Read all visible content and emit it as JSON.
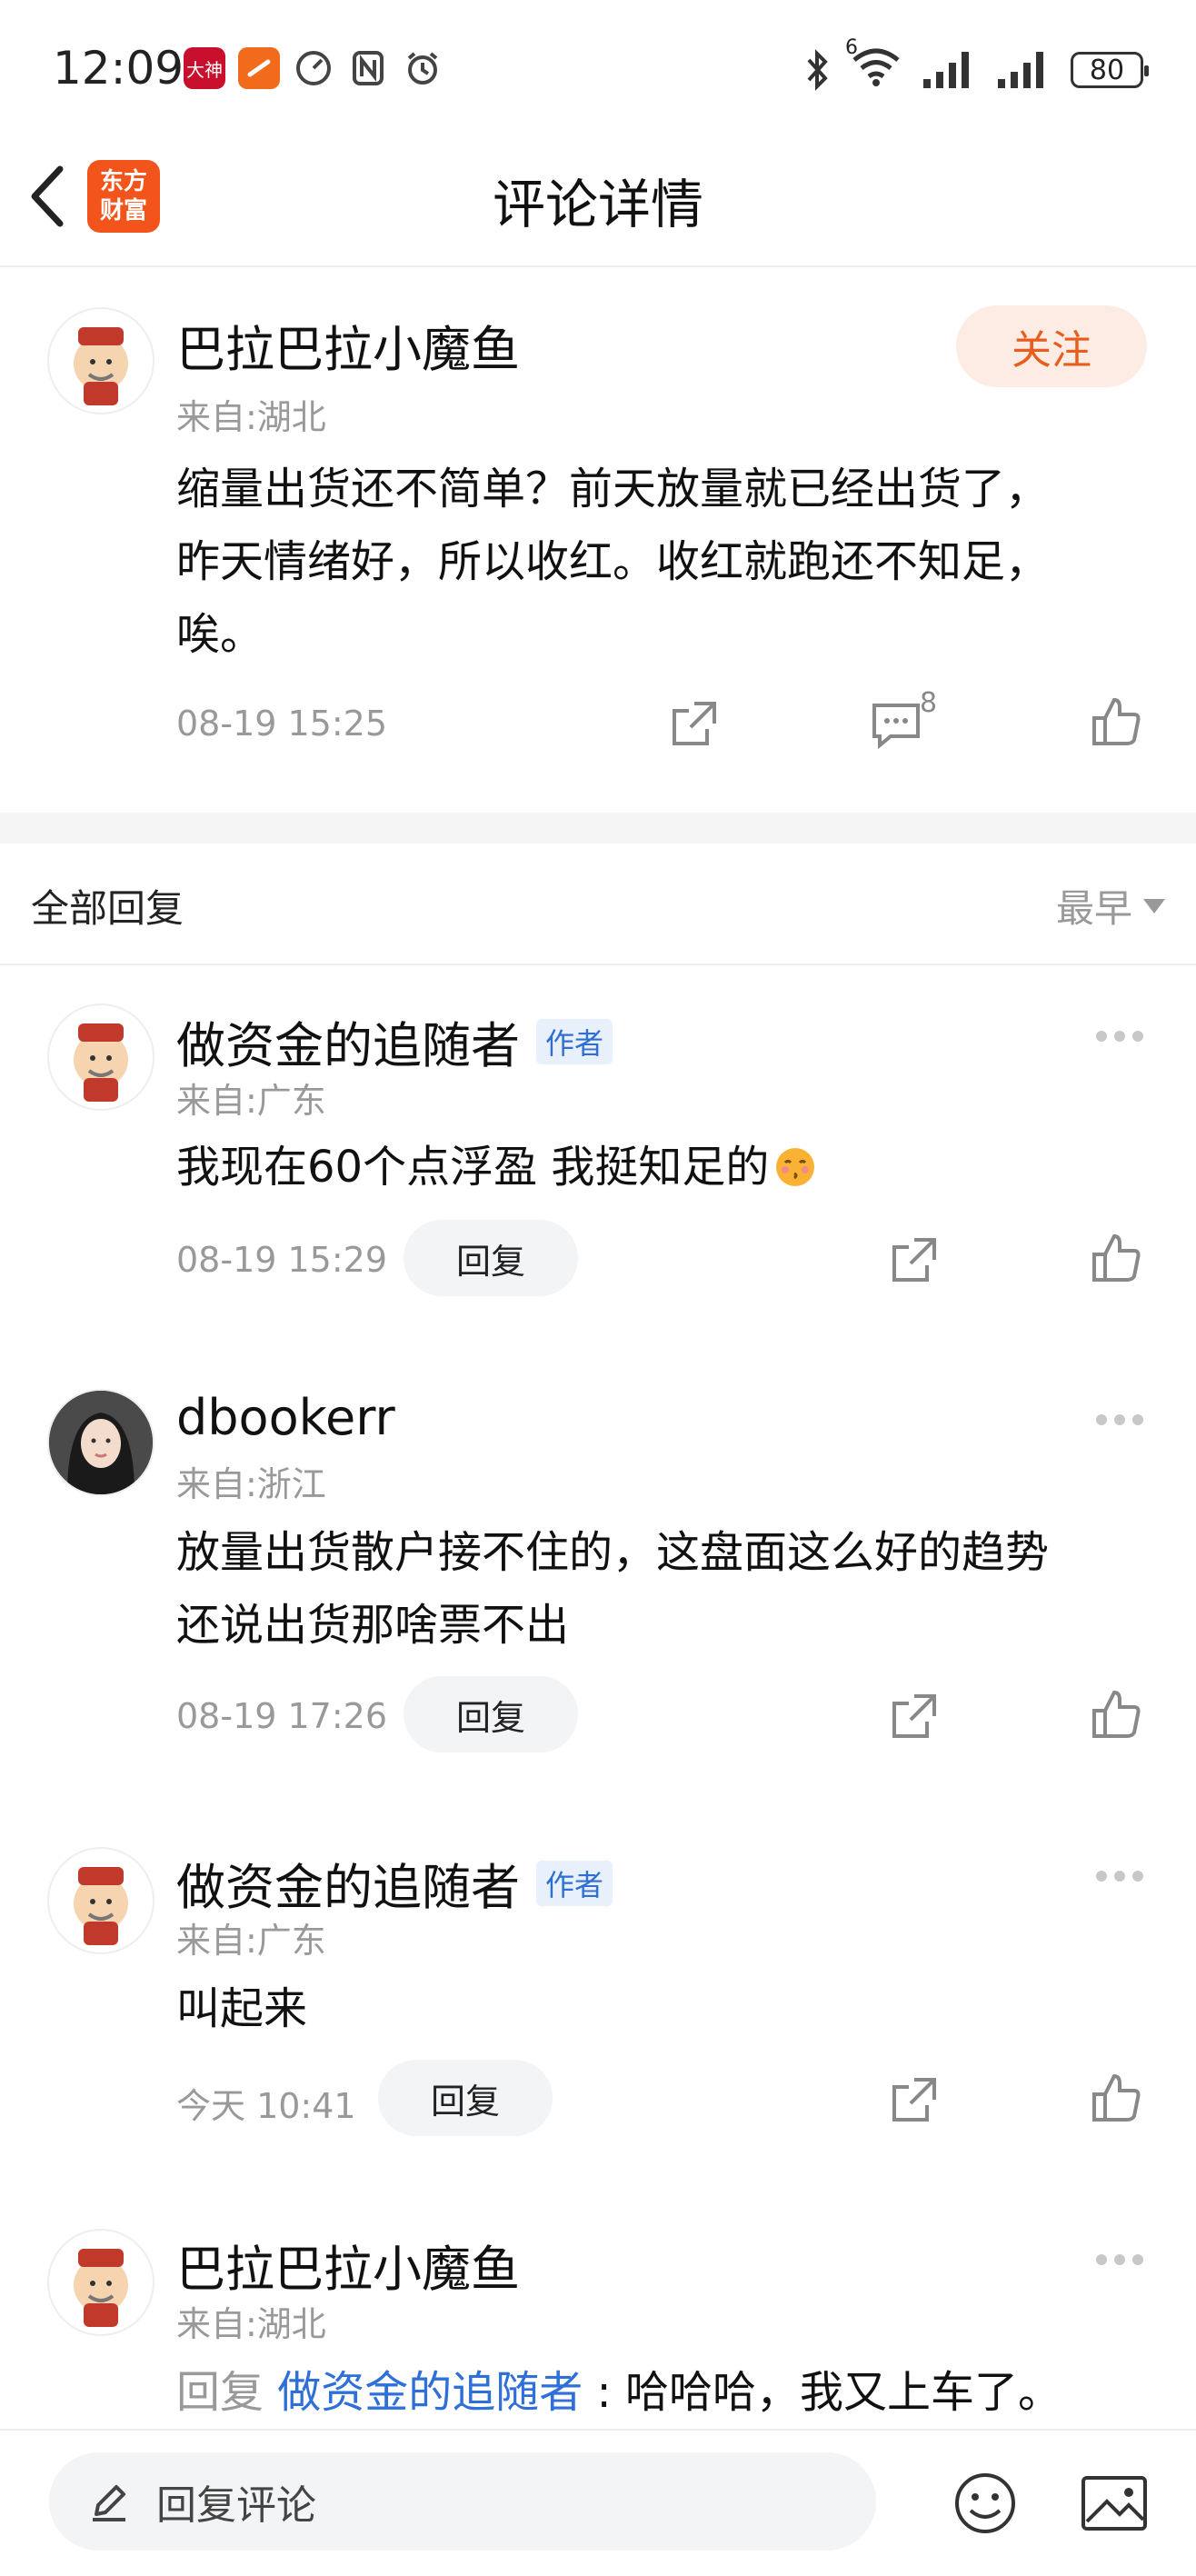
{
  "status_bar": {
    "time": "12:09",
    "left_icons": [
      "dashen-app-icon",
      "toutiao-app-icon",
      "speed-icon",
      "nfc-icon",
      "alarm-icon"
    ],
    "dashen_label": "大神",
    "network_label": "6",
    "battery": "80"
  },
  "header": {
    "title": "评论详情",
    "logo_line1": "东方",
    "logo_line2": "财富"
  },
  "main_comment": {
    "user": "巴拉巴拉小魔鱼",
    "location": "来自:湖北",
    "follow_label": "关注",
    "line1": "缩量出货还不简单？前天放量就已经出货了，",
    "line2": "昨天情绪好，所以收红。收红就跑还不知足，",
    "line3": "唉。",
    "time": "08-19 15:25",
    "reply_count": "8"
  },
  "replies_header": {
    "title": "全部回复",
    "sort": "最早"
  },
  "replies": [
    {
      "user": "做资金的追随者",
      "tag": "作者",
      "location": "来自:广东",
      "text": "我现在60个点浮盈 我挺知足的",
      "time": "08-19 15:29",
      "reply_label": "回复"
    },
    {
      "user": "dbookerr",
      "location": "来自:浙江",
      "line1": "放量出货散户接不住的，这盘面这么好的趋势",
      "line2": "还说出货那啥票不出",
      "time": "08-19 17:26",
      "reply_label": "回复"
    },
    {
      "user": "做资金的追随者",
      "tag": "作者",
      "location": "来自:广东",
      "text": "叫起来",
      "time": "今天 10:41",
      "reply_label": "回复"
    },
    {
      "user": "巴拉巴拉小魔鱼",
      "location": "来自:湖北",
      "prefix": "回复 ",
      "target": "做资金的追随者",
      "text": " : 哈哈哈，我又上车了。"
    }
  ],
  "bottom_bar": {
    "placeholder": "回复评论"
  },
  "colors": {
    "accent_orange": "#e85c1d",
    "link_blue": "#2e6fd8",
    "logo_bg": "#f2541b"
  }
}
